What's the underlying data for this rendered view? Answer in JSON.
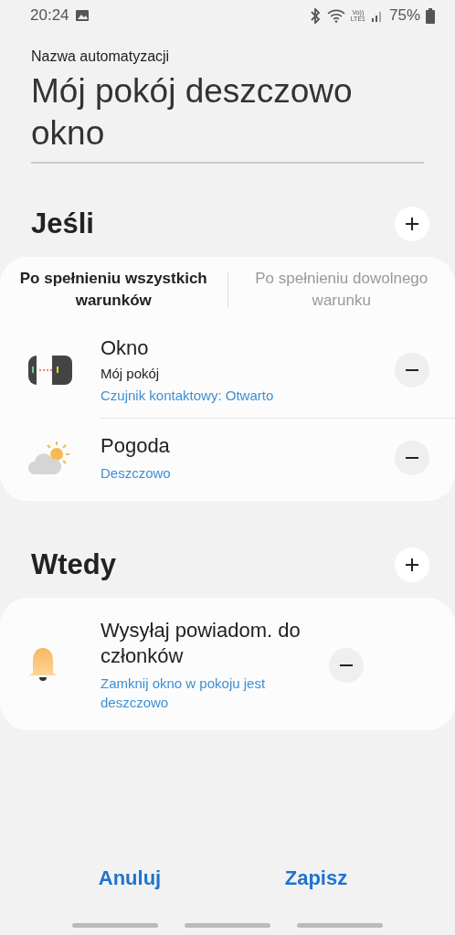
{
  "status_bar": {
    "time": "20:24",
    "network_top": "Vo))",
    "network_bottom": "LTE1",
    "battery": "75%"
  },
  "automation_name": {
    "label": "Nazwa automatyzacji",
    "value": "Mój pokój deszczowo okno"
  },
  "if_section": {
    "title": "Jeśli",
    "tabs": [
      {
        "label": "Po spełnieniu wszystkich warunków",
        "selected": true
      },
      {
        "label": "Po spełnieniu dowolnego warunku",
        "selected": false
      }
    ],
    "items": [
      {
        "kind": "contact-sensor",
        "title": "Okno",
        "subtitle": "Mój pokój",
        "detail": "Czujnik kontaktowy: Otwarto"
      },
      {
        "kind": "weather",
        "title": "Pogoda",
        "detail": "Deszczowo"
      }
    ]
  },
  "then_section": {
    "title": "Wtedy",
    "items": [
      {
        "kind": "notification",
        "title": "Wysyłaj powiadom. do członków",
        "detail": "Zamknij okno w pokoju jest deszczowo"
      }
    ]
  },
  "buttons": [
    {
      "label": "Anuluj"
    },
    {
      "label": "Zapisz"
    }
  ]
}
